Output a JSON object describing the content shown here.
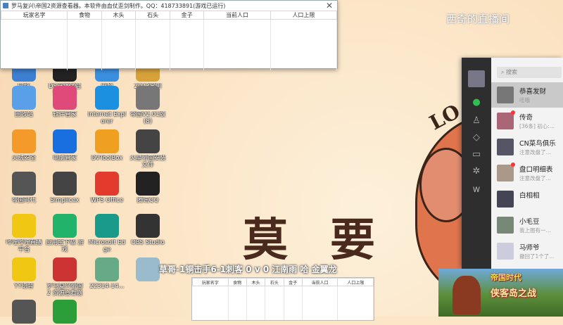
{
  "overlay": {
    "watermark": "西奇的直播间",
    "art_text_lo": "LO",
    "art_text_cn": "莫要",
    "ticker": "草哥-1铜击手6-1刺客 0 v 0 江南雨 哈 金翼龙"
  },
  "tool_window": {
    "title": "罗马复兴\\帝国2资源查看器。本软件由血仗歪剑制作。QQ：418733891(游戏已运行)",
    "close_label": "✕",
    "columns": [
      "玩家名字",
      "食物",
      "木头",
      "石头",
      "金子",
      "当前人口",
      "人口上限"
    ]
  },
  "tool_window_2": {
    "columns": [
      "玩家名字",
      "食物",
      "木头",
      "石头",
      "金子",
      "当前人口",
      "人口上限"
    ]
  },
  "desktop_icons": [
    {
      "label": "网络",
      "icon": "network-icon",
      "color": "#3d7fd0"
    },
    {
      "label": "DS直播伴侣\n安装文件",
      "icon": "live-icon",
      "color": "#222"
    },
    {
      "label": "电脑",
      "icon": "computer-icon",
      "color": "#3a8fe0"
    },
    {
      "label": "2023案例",
      "icon": "folder-icon",
      "color": "#d8a23a"
    },
    {
      "label": "回收站",
      "icon": "recycle-bin-icon",
      "color": "#5aa0e8"
    },
    {
      "label": "软件管家",
      "icon": "app-store-icon",
      "color": "#e04a7a"
    },
    {
      "label": "Internet\nExplorer",
      "icon": "ie-icon",
      "color": "#1b8fe0"
    },
    {
      "label": "帝国V2.01版\n(8)",
      "icon": "game-icon",
      "color": "#777"
    },
    {
      "label": "火绒安全",
      "icon": "shield-icon",
      "color": "#f39a2a"
    },
    {
      "label": "电脑管家",
      "icon": "guard-icon",
      "color": "#1a6fe0"
    },
    {
      "label": "DVToolBox",
      "icon": "toolbox-icon",
      "color": "#f0a020"
    },
    {
      "label": "火星帝国安装文件",
      "icon": "installer-icon",
      "color": "#444"
    },
    {
      "label": "帝国时代",
      "icon": "dragon-icon",
      "color": "#555"
    },
    {
      "label": "Simplicex",
      "icon": "media-icon",
      "color": "#444"
    },
    {
      "label": "WPS Office",
      "icon": "wps-icon",
      "color": "#e23b2e"
    },
    {
      "label": "腾讯QQ",
      "icon": "qq-icon",
      "color": "#222"
    },
    {
      "label": "哔哩哔哩直播\n平台",
      "icon": "bilibili-icon",
      "color": "#f0c814"
    },
    {
      "label": "应用宝下载\n游戏",
      "icon": "android-icon",
      "color": "#21b36a"
    },
    {
      "label": "Microsoft\nEdge",
      "icon": "edge-icon",
      "color": "#1a9b8a"
    },
    {
      "label": "OBS Studio",
      "icon": "obs-icon",
      "color": "#333"
    },
    {
      "label": "YY语音",
      "icon": "yy-icon",
      "color": "#f0c814"
    },
    {
      "label": "罗马复兴帝国2\n资源查看器",
      "icon": "viewer-icon",
      "color": "#c33"
    },
    {
      "label": "22314-14...",
      "icon": "image-icon",
      "color": "#6a8"
    },
    {
      "label": "",
      "icon": "bear-icon",
      "color": "#9bc"
    },
    {
      "label": "",
      "icon": "dragon-icon",
      "color": "#555"
    },
    {
      "label": "",
      "icon": "ie2-icon",
      "color": "#2b9e3a"
    }
  ],
  "chat": {
    "search_placeholder": "搜索",
    "conversations": [
      {
        "name": "恭喜发财",
        "msg": "哇哦",
        "color": "#777",
        "badge": false
      },
      {
        "name": "传奇",
        "msg": "[36条] 初心:...",
        "color": "#a67",
        "badge": true
      },
      {
        "name": "CN菜鸟俱乐",
        "msg": "注意改盘了...",
        "color": "#556",
        "badge": false
      },
      {
        "name": "盘口明细表",
        "msg": "注意改盘了...",
        "color": "#a98",
        "badge": true
      },
      {
        "name": "白相相",
        "msg": "",
        "color": "#445",
        "badge": false
      },
      {
        "name": "小毛豆",
        "msg": "我上图有一...",
        "color": "#787",
        "badge": false
      },
      {
        "name": "马师爷",
        "msg": "撤回了1个了...",
        "color": "#ccd",
        "badge": false
      }
    ]
  },
  "game_banner": {
    "title1": "帝国时代",
    "title2": "侠客岛之战"
  }
}
